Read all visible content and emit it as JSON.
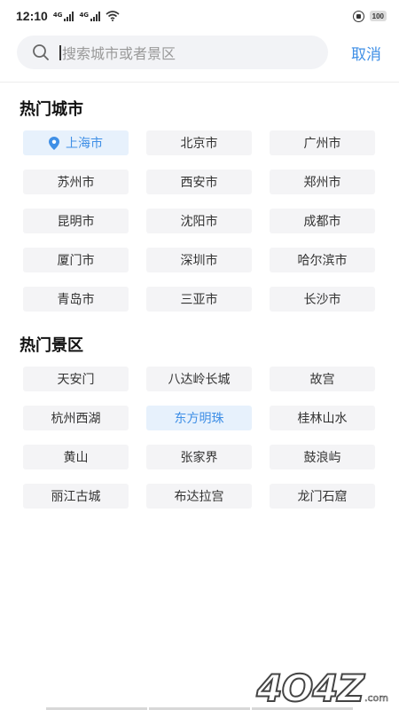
{
  "status_bar": {
    "time": "12:10",
    "signal_label_1": "4G",
    "signal_label_2": "4G",
    "battery": "100"
  },
  "search": {
    "placeholder": "搜索城市或者景区",
    "cancel_label": "取消"
  },
  "hot_cities": {
    "title": "热门城市",
    "items": [
      {
        "label": "上海市",
        "selected": true,
        "icon": "location-pin-icon"
      },
      {
        "label": "北京市"
      },
      {
        "label": "广州市"
      },
      {
        "label": "苏州市"
      },
      {
        "label": "西安市"
      },
      {
        "label": "郑州市"
      },
      {
        "label": "昆明市"
      },
      {
        "label": "沈阳市"
      },
      {
        "label": "成都市"
      },
      {
        "label": "厦门市"
      },
      {
        "label": "深圳市"
      },
      {
        "label": "哈尔滨市"
      },
      {
        "label": "青岛市"
      },
      {
        "label": "三亚市"
      },
      {
        "label": "长沙市"
      }
    ]
  },
  "hot_scenic": {
    "title": "热门景区",
    "items": [
      {
        "label": "天安门"
      },
      {
        "label": "八达岭长城"
      },
      {
        "label": "故宫"
      },
      {
        "label": "杭州西湖"
      },
      {
        "label": "东方明珠",
        "selected": true
      },
      {
        "label": "桂林山水"
      },
      {
        "label": "黄山"
      },
      {
        "label": "张家界"
      },
      {
        "label": "鼓浪屿"
      },
      {
        "label": "丽江古城"
      },
      {
        "label": "布达拉宫"
      },
      {
        "label": "龙门石窟"
      }
    ]
  },
  "watermark": {
    "text": "4O4Z",
    "suffix": ".com"
  },
  "colors": {
    "accent": "#3f8fe6",
    "chip_bg": "#f4f4f6",
    "chip_selected_bg": "#e7f1fc"
  }
}
